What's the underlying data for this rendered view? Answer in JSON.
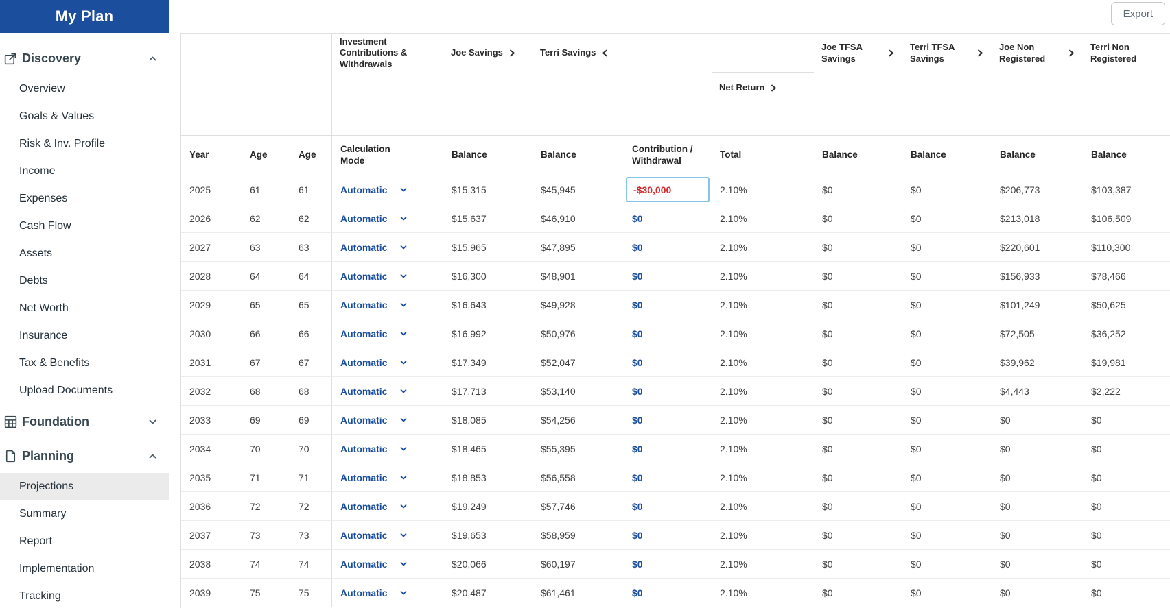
{
  "sidebar": {
    "title": "My Plan",
    "sections": [
      {
        "label": "Discovery",
        "icon": "discovery-icon",
        "chevron": "up",
        "items": [
          {
            "label": "Overview"
          },
          {
            "label": "Goals & Values"
          },
          {
            "label": "Risk & Inv. Profile"
          },
          {
            "label": "Income"
          },
          {
            "label": "Expenses"
          },
          {
            "label": "Cash Flow"
          },
          {
            "label": "Assets"
          },
          {
            "label": "Debts"
          },
          {
            "label": "Net Worth"
          },
          {
            "label": "Insurance"
          },
          {
            "label": "Tax & Benefits"
          },
          {
            "label": "Upload Documents"
          }
        ]
      },
      {
        "label": "Foundation",
        "icon": "foundation-icon",
        "chevron": "down",
        "items": []
      },
      {
        "label": "Planning",
        "icon": "planning-icon",
        "chevron": "up",
        "items": [
          {
            "label": "Projections",
            "selected": true
          },
          {
            "label": "Summary"
          },
          {
            "label": "Report"
          },
          {
            "label": "Implementation"
          },
          {
            "label": "Tracking"
          }
        ]
      }
    ]
  },
  "toolbar": {
    "export_label": "Export"
  },
  "table": {
    "group_headers": [
      {
        "label": "",
        "span": 3,
        "divider": true
      },
      {
        "label": "Investment Contributions & Withdrawals"
      },
      {
        "label": "Joe Savings",
        "chevron": "right"
      },
      {
        "label": "Terri Savings",
        "chevron": "left"
      },
      {
        "label": ""
      },
      {
        "label": "Net Return",
        "chevron": "right",
        "nested": true
      },
      {
        "label": "Joe TFSA Savings",
        "chevron": "right"
      },
      {
        "label": "Terri TFSA Savings",
        "chevron": "right"
      },
      {
        "label": "Joe Non Registered",
        "chevron": "right"
      },
      {
        "label": "Terri Non Registered",
        "chevron": "right"
      }
    ],
    "columns": [
      "Year",
      "Age",
      "Age",
      "Calculation Mode",
      "Balance",
      "Balance",
      "Contribution / Withdrawal",
      "Total",
      "Balance",
      "Balance",
      "Balance",
      "Balance"
    ],
    "rows": [
      {
        "year": "2025",
        "age1": "61",
        "age2": "61",
        "mode": "Automatic",
        "joe_savings": "$15,315",
        "terri_savings": "$45,945",
        "contribution": "-$30,000",
        "contribution_negative": true,
        "contribution_selected": true,
        "net_return_total": "2.10%",
        "joe_tfsa": "$0",
        "terri_tfsa": "$0",
        "joe_non_registered": "$206,773",
        "terri_non_registered": "$103,387"
      },
      {
        "year": "2026",
        "age1": "62",
        "age2": "62",
        "mode": "Automatic",
        "joe_savings": "$15,637",
        "terri_savings": "$46,910",
        "contribution": "$0",
        "net_return_total": "2.10%",
        "joe_tfsa": "$0",
        "terri_tfsa": "$0",
        "joe_non_registered": "$213,018",
        "terri_non_registered": "$106,509"
      },
      {
        "year": "2027",
        "age1": "63",
        "age2": "63",
        "mode": "Automatic",
        "joe_savings": "$15,965",
        "terri_savings": "$47,895",
        "contribution": "$0",
        "net_return_total": "2.10%",
        "joe_tfsa": "$0",
        "terri_tfsa": "$0",
        "joe_non_registered": "$220,601",
        "terri_non_registered": "$110,300"
      },
      {
        "year": "2028",
        "age1": "64",
        "age2": "64",
        "mode": "Automatic",
        "joe_savings": "$16,300",
        "terri_savings": "$48,901",
        "contribution": "$0",
        "net_return_total": "2.10%",
        "joe_tfsa": "$0",
        "terri_tfsa": "$0",
        "joe_non_registered": "$156,933",
        "terri_non_registered": "$78,466"
      },
      {
        "year": "2029",
        "age1": "65",
        "age2": "65",
        "mode": "Automatic",
        "joe_savings": "$16,643",
        "terri_savings": "$49,928",
        "contribution": "$0",
        "net_return_total": "2.10%",
        "joe_tfsa": "$0",
        "terri_tfsa": "$0",
        "joe_non_registered": "$101,249",
        "terri_non_registered": "$50,625"
      },
      {
        "year": "2030",
        "age1": "66",
        "age2": "66",
        "mode": "Automatic",
        "joe_savings": "$16,992",
        "terri_savings": "$50,976",
        "contribution": "$0",
        "net_return_total": "2.10%",
        "joe_tfsa": "$0",
        "terri_tfsa": "$0",
        "joe_non_registered": "$72,505",
        "terri_non_registered": "$36,252"
      },
      {
        "year": "2031",
        "age1": "67",
        "age2": "67",
        "mode": "Automatic",
        "joe_savings": "$17,349",
        "terri_savings": "$52,047",
        "contribution": "$0",
        "net_return_total": "2.10%",
        "joe_tfsa": "$0",
        "terri_tfsa": "$0",
        "joe_non_registered": "$39,962",
        "terri_non_registered": "$19,981"
      },
      {
        "year": "2032",
        "age1": "68",
        "age2": "68",
        "mode": "Automatic",
        "joe_savings": "$17,713",
        "terri_savings": "$53,140",
        "contribution": "$0",
        "net_return_total": "2.10%",
        "joe_tfsa": "$0",
        "terri_tfsa": "$0",
        "joe_non_registered": "$4,443",
        "terri_non_registered": "$2,222"
      },
      {
        "year": "2033",
        "age1": "69",
        "age2": "69",
        "mode": "Automatic",
        "joe_savings": "$18,085",
        "terri_savings": "$54,256",
        "contribution": "$0",
        "net_return_total": "2.10%",
        "joe_tfsa": "$0",
        "terri_tfsa": "$0",
        "joe_non_registered": "$0",
        "terri_non_registered": "$0"
      },
      {
        "year": "2034",
        "age1": "70",
        "age2": "70",
        "mode": "Automatic",
        "joe_savings": "$18,465",
        "terri_savings": "$55,395",
        "contribution": "$0",
        "net_return_total": "2.10%",
        "joe_tfsa": "$0",
        "terri_tfsa": "$0",
        "joe_non_registered": "$0",
        "terri_non_registered": "$0"
      },
      {
        "year": "2035",
        "age1": "71",
        "age2": "71",
        "mode": "Automatic",
        "joe_savings": "$18,853",
        "terri_savings": "$56,558",
        "contribution": "$0",
        "net_return_total": "2.10%",
        "joe_tfsa": "$0",
        "terri_tfsa": "$0",
        "joe_non_registered": "$0",
        "terri_non_registered": "$0"
      },
      {
        "year": "2036",
        "age1": "72",
        "age2": "72",
        "mode": "Automatic",
        "joe_savings": "$19,249",
        "terri_savings": "$57,746",
        "contribution": "$0",
        "net_return_total": "2.10%",
        "joe_tfsa": "$0",
        "terri_tfsa": "$0",
        "joe_non_registered": "$0",
        "terri_non_registered": "$0"
      },
      {
        "year": "2037",
        "age1": "73",
        "age2": "73",
        "mode": "Automatic",
        "joe_savings": "$19,653",
        "terri_savings": "$58,959",
        "contribution": "$0",
        "net_return_total": "2.10%",
        "joe_tfsa": "$0",
        "terri_tfsa": "$0",
        "joe_non_registered": "$0",
        "terri_non_registered": "$0"
      },
      {
        "year": "2038",
        "age1": "74",
        "age2": "74",
        "mode": "Automatic",
        "joe_savings": "$20,066",
        "terri_savings": "$60,197",
        "contribution": "$0",
        "net_return_total": "2.10%",
        "joe_tfsa": "$0",
        "terri_tfsa": "$0",
        "joe_non_registered": "$0",
        "terri_non_registered": "$0"
      },
      {
        "year": "2039",
        "age1": "75",
        "age2": "75",
        "mode": "Automatic",
        "joe_savings": "$20,487",
        "terri_savings": "$61,461",
        "contribution": "$0",
        "net_return_total": "2.10%",
        "joe_tfsa": "$0",
        "terri_tfsa": "$0",
        "joe_non_registered": "$0",
        "terri_non_registered": "$0"
      }
    ]
  },
  "colors": {
    "brand_blue": "#1b4f9e",
    "link_blue": "#1b4f9e",
    "negative_red": "#d32f2f",
    "selected_cell_border": "#86c5ea",
    "selected_nav_bg": "#ebebeb"
  }
}
